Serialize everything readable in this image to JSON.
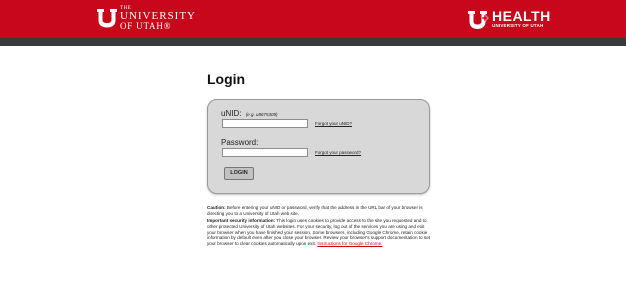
{
  "header": {
    "university_the": "THE",
    "university_line1": "UNIVERSITY",
    "university_line2": "OF UTAH®",
    "health_title": "HEALTH",
    "health_subtitle": "UNIVERSITY OF UTAH"
  },
  "login": {
    "title": "Login",
    "unid_label": "uNID:",
    "unid_hint": "(e.g. u8675309)",
    "unid_value": "",
    "forgot_unid": "Forgot your uNID?",
    "password_label": "Password:",
    "password_value": "",
    "forgot_password": "Forgot your password?",
    "login_button": "LOGIN"
  },
  "notice": {
    "caution_label": "Caution:",
    "caution_text": " Before entering your uNID or password, verify that the address in the URL bar of your browser is directing you to a University of Utah web site.",
    "security_label": "Important security information:",
    "security_text": " This login uses cookies to provide access to the site you requested and to other protected University of Utah websites. For your security, log out of the services you are using and exit your browser when you have finished your session. Some browsers, including Google Chrome, retain cookie information by default even after you close your browser. Review your browser's support documentation to set your browser to clear cookies automatically upon exit. ",
    "chrome_link": "Instructions for Google Chrome."
  },
  "colors": {
    "brand_red": "#c8081a",
    "dark_bar": "#3a3a3a",
    "panel_bg": "#d8d8d8"
  }
}
